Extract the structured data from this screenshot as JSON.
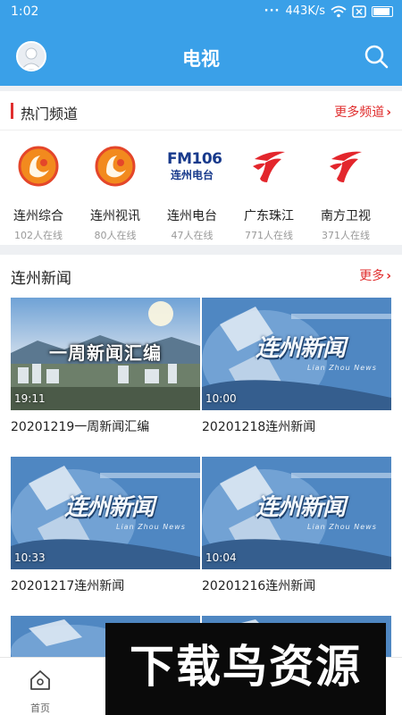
{
  "status_bar": {
    "time": "1:02",
    "network_speed": "443K/s"
  },
  "header": {
    "title": "电视"
  },
  "hot_channels": {
    "title": "热门频道",
    "more_label": "更多频道",
    "items": [
      {
        "name": "连州综合",
        "viewers": "102人在线",
        "logo": "lianzhou-tv-logo"
      },
      {
        "name": "连州视讯",
        "viewers": "80人在线",
        "logo": "lianzhou-tv-logo"
      },
      {
        "name": "连州电台",
        "viewers": "47人在线",
        "logo": "fm106-logo",
        "logo_text_top": "FM106",
        "logo_text_bottom": "连州电台"
      },
      {
        "name": "广东珠江",
        "viewers": "771人在线",
        "logo": "guangdong-tv-logo"
      },
      {
        "name": "南方卫视",
        "viewers": "371人在线",
        "logo": "guangdong-tv-logo"
      }
    ]
  },
  "news": {
    "title": "连州新闻",
    "more_label": "更多",
    "videos": [
      {
        "title": "20201219一周新闻汇编",
        "duration": "19:11",
        "thumb_style": "cityscape",
        "thumb_text": "一周新闻汇编"
      },
      {
        "title": "20201218连州新闻",
        "duration": "10:00",
        "thumb_style": "newsroom",
        "thumb_text": "连州新闻",
        "thumb_subtext": "Lian Zhou News"
      },
      {
        "title": "20201217连州新闻",
        "duration": "10:33",
        "thumb_style": "newsroom",
        "thumb_text": "连州新闻",
        "thumb_subtext": "Lian Zhou News"
      },
      {
        "title": "20201216连州新闻",
        "duration": "10:04",
        "thumb_style": "newsroom",
        "thumb_text": "连州新闻",
        "thumb_subtext": "Lian Zhou News"
      }
    ]
  },
  "bottom_nav": {
    "home_label": "首页"
  },
  "watermark": {
    "text": "下载鸟资源"
  },
  "colors": {
    "header_blue": "#3aa0e8",
    "accent_red": "#e02e2e"
  }
}
